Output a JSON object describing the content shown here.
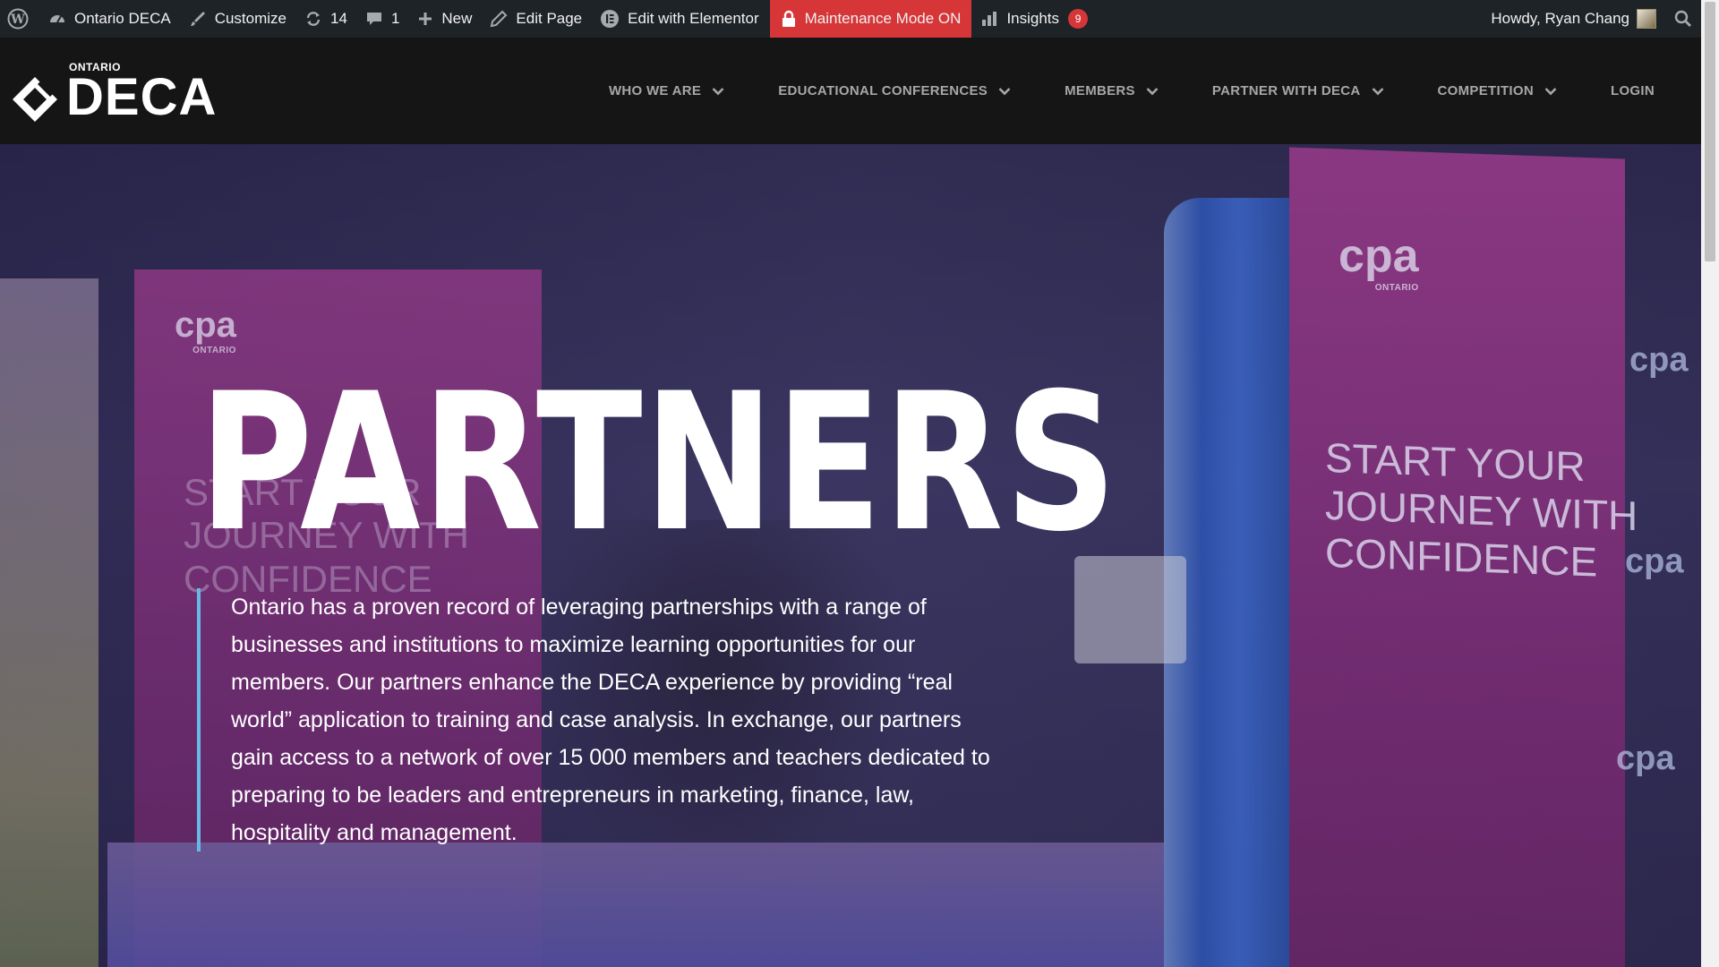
{
  "adminbar": {
    "site_name": "Ontario DECA",
    "customize": "Customize",
    "updates_count": "14",
    "comments_count": "1",
    "new_label": "New",
    "edit_page": "Edit Page",
    "edit_elementor": "Edit with Elementor",
    "maintenance": "Maintenance Mode ON",
    "insights": "Insights",
    "insights_badge": "9",
    "howdy": "Howdy, Ryan Chang",
    "maintenance_color": "#d63638"
  },
  "header": {
    "logo_small": "ONTARIO",
    "logo_big": "DECA",
    "nav": [
      {
        "label": "WHO WE ARE",
        "has_dropdown": true
      },
      {
        "label": "EDUCATIONAL CONFERENCES",
        "has_dropdown": true
      },
      {
        "label": "MEMBERS",
        "has_dropdown": true
      },
      {
        "label": "PARTNER WITH DECA",
        "has_dropdown": true
      },
      {
        "label": "COMPETITION",
        "has_dropdown": true
      },
      {
        "label": "LOGIN",
        "has_dropdown": false
      }
    ]
  },
  "hero": {
    "title": "PARTNERS",
    "body": "Ontario has a proven record of leveraging partnerships with a range of businesses and institutions to maximize learning opportunities for our members. Our partners enhance the DECA experience by providing “real world” application to training and case analysis. In exchange, our partners gain access to a network of over 15 000 members and teachers dedicated to preparing to be leaders and entrepreneurs in marketing, finance, law, hospitality and management.",
    "accent_color": "#67b9e6",
    "photo": {
      "cpa_logo": "cpa",
      "cpa_sub": "ONTARIO",
      "banner_line1": "START YOUR",
      "banner_line2": "JOURNEY WITH",
      "banner_line3": "CONFIDENCE"
    }
  }
}
